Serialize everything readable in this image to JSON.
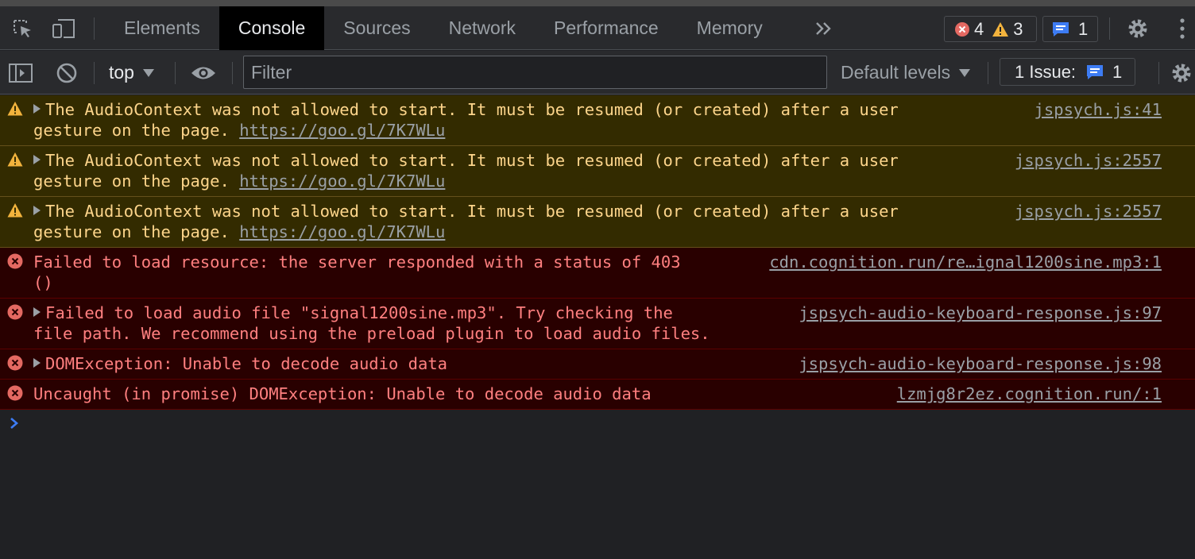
{
  "tabs": [
    {
      "label": "Elements"
    },
    {
      "label": "Console"
    },
    {
      "label": "Sources"
    },
    {
      "label": "Network"
    },
    {
      "label": "Performance"
    },
    {
      "label": "Memory"
    }
  ],
  "active_tab": "Console",
  "counts": {
    "errors": "4",
    "warnings": "3",
    "info": "1"
  },
  "issues_badge": {
    "count": "1"
  },
  "toolbar": {
    "context": "top",
    "filter_placeholder": "Filter",
    "levels": "Default levels",
    "issues_label": "1 Issue:",
    "issues_count": "1"
  },
  "messages": [
    {
      "level": "warning",
      "expandable": true,
      "line1": "The AudioContext was not allowed to start. It must be resumed (or created) after a user",
      "line2_text": "gesture on the page. ",
      "line2_link": "https://goo.gl/7K7WLu",
      "source": "jspsych.js:41"
    },
    {
      "level": "warning",
      "expandable": true,
      "line1": "The AudioContext was not allowed to start. It must be resumed (or created) after a user",
      "line2_text": "gesture on the page. ",
      "line2_link": "https://goo.gl/7K7WLu",
      "source": "jspsych.js:2557"
    },
    {
      "level": "warning",
      "expandable": true,
      "line1": "The AudioContext was not allowed to start. It must be resumed (or created) after a user",
      "line2_text": "gesture on the page. ",
      "line2_link": "https://goo.gl/7K7WLu",
      "source": "jspsych.js:2557"
    },
    {
      "level": "error",
      "expandable": false,
      "line1": "Failed to load resource: the server responded with a status of 403",
      "line2_text": "()",
      "line2_link": "",
      "source": "cdn.cognition.run/re…ignal1200sine.mp3:1"
    },
    {
      "level": "error",
      "expandable": true,
      "line1": "Failed to load audio file \"signal1200sine.mp3\". Try checking the",
      "line2_text": "file path. We recommend using the preload plugin to load audio files.",
      "line2_link": "",
      "source": "jspsych-audio-keyboard-response.js:97"
    },
    {
      "level": "error",
      "expandable": true,
      "line1": "DOMException: Unable to decode audio data",
      "line2_text": "",
      "line2_link": "",
      "source": "jspsych-audio-keyboard-response.js:98"
    },
    {
      "level": "error",
      "expandable": false,
      "line1": "Uncaught (in promise) DOMException: Unable to decode audio data",
      "line2_text": "",
      "line2_link": "",
      "source": "lzmjg8r2ez.cognition.run/:1"
    }
  ],
  "colors": {
    "warning_bg": "#332b00",
    "warning_text": "#fdd58b",
    "error_bg": "#290000",
    "error_text": "#ff8080",
    "accent_blue": "#1a73e8"
  }
}
